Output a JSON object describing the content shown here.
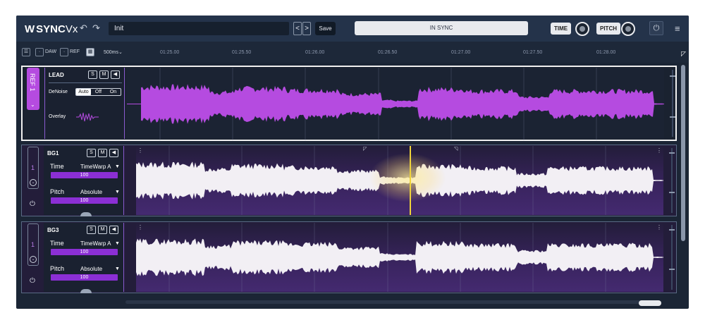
{
  "topbar": {
    "logo_mark": "W",
    "app_name_bold": "SYNC",
    "app_name_light": "Vx",
    "undo_icon": "undo-icon",
    "redo_icon": "redo-icon",
    "preset_name": "Init",
    "prev_label": "<",
    "next_label": ">",
    "save_label": "Save",
    "sync_status": "IN SYNC",
    "time_label": "TIME",
    "pitch_label": "PITCH",
    "power_icon": "power-icon",
    "menu_icon": "menu-icon"
  },
  "ruler": {
    "list_icon": "list-icon",
    "daw_label": "DAW",
    "ref_label": "REF",
    "grid_icon": "grid-icon",
    "resolution": "500ms",
    "timestamps": [
      "01:25.00",
      "01:25.50",
      "01:26.00",
      "01:26.50",
      "01:27.00",
      "01:27.50",
      "01:28.00"
    ]
  },
  "tracks": [
    {
      "tab": "REF 1",
      "name": "LEAD",
      "solo": "S",
      "mute": "M",
      "speaker_icon": "speaker-icon",
      "denoise_label": "DeNoise",
      "denoise_options": [
        "Auto",
        "Off",
        "On"
      ],
      "denoise_selected": "Auto",
      "overlay_label": "Overlay",
      "wave_color": "#b54be0"
    },
    {
      "tab_number": "1",
      "name": "BG1",
      "solo": "S",
      "mute": "M",
      "speaker_icon": "speaker-icon",
      "time_label": "Time",
      "time_mode": "TimeWarp A",
      "time_value": "100",
      "time_fraction": 1.0,
      "pitch_label": "Pitch",
      "pitch_mode": "Absolute",
      "pitch_value": "100",
      "pitch_fraction": 1.0,
      "wave_color": "#f2eff4"
    },
    {
      "tab_number": "1",
      "name": "BG3",
      "solo": "S",
      "mute": "M",
      "speaker_icon": "speaker-icon",
      "time_label": "Time",
      "time_mode": "TimeWarp A",
      "time_value": "100",
      "time_fraction": 1.0,
      "pitch_label": "Pitch",
      "pitch_mode": "Absolute",
      "pitch_value": "100",
      "pitch_fraction": 1.0,
      "wave_color": "#f2eff4"
    }
  ],
  "colors": {
    "accent": "#b54be0",
    "playhead": "#f0d43a",
    "background": "#1b2535"
  }
}
